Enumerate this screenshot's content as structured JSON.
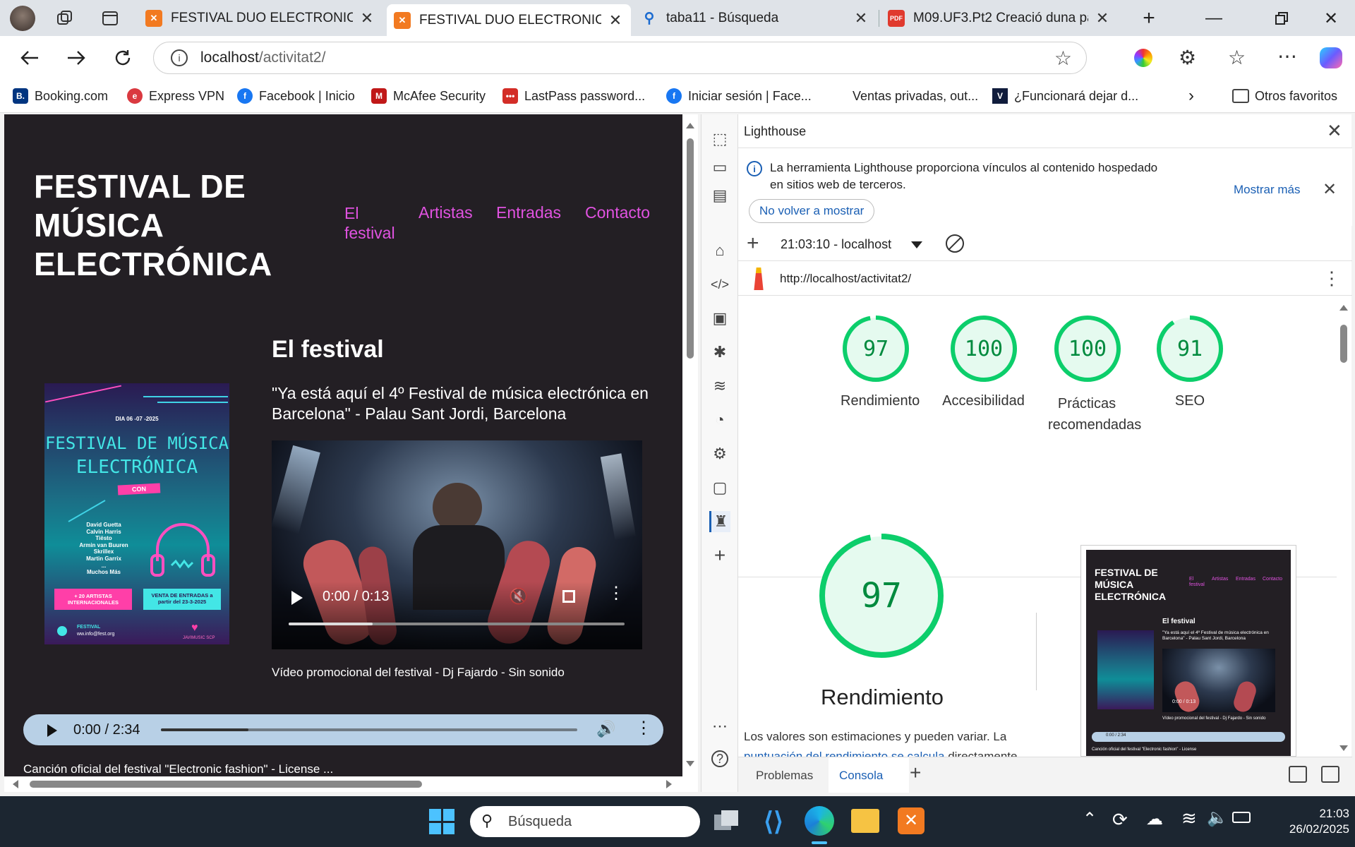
{
  "browser": {
    "tabs": [
      {
        "title": "FESTIVAL DUO ELECTRONIC",
        "icon": "xampp-icon"
      },
      {
        "title": "FESTIVAL DUO ELECTRONIC",
        "icon": "xampp-icon",
        "active": true
      },
      {
        "title": "taba11 - Búsqueda",
        "icon": "search-icon"
      },
      {
        "title": "M09.UF3.Pt2 Creació duna pàgin",
        "icon": "pdf-icon"
      }
    ],
    "url_host": "localhost",
    "url_path": "/activitat2/",
    "bookmarks": [
      {
        "label": "Booking.com",
        "icon": "booking-icon"
      },
      {
        "label": "Express VPN",
        "icon": "expressvpn-icon"
      },
      {
        "label": "Facebook | Inicio",
        "icon": "facebook-icon"
      },
      {
        "label": "McAfee Security",
        "icon": "mcafee-icon"
      },
      {
        "label": "LastPass password...",
        "icon": "lastpass-icon"
      },
      {
        "label": "Iniciar sesión | Face...",
        "icon": "facebook-icon"
      },
      {
        "label": "Ventas privadas, out...",
        "icon": ""
      },
      {
        "label": "¿Funcionará dejar d...",
        "icon": "v-icon"
      }
    ],
    "other_favorites": "Otros favoritos"
  },
  "site": {
    "title_lines": [
      "FESTIVAL DE",
      "MÚSICA",
      "ELECTRÓNICA"
    ],
    "nav": [
      "El festival",
      "Artistas",
      "Entradas",
      "Contacto"
    ],
    "section_title": "El festival",
    "quote": "\"Ya está aquí el 4º Festival de música electrónica en Barcelona\" - Palau Sant Jordi, Barcelona",
    "video_time": "0:00 / 0:13",
    "video_caption": "Vídeo promocional del festival - Dj Fajardo - Sin sonido",
    "audio_time": "0:00 / 2:34",
    "audio_caption": "Canción oficial del festival \"Electronic fashion\" - License ...",
    "poster": {
      "date": "DIA 06 -07 -2025",
      "title_lines": [
        "FESTIVAL DE MÚSICA",
        "ELECTRÓNICA"
      ],
      "con": "CON",
      "artists": [
        "David Guetta",
        "Calvin Harris",
        "Tiësto",
        "Armin van Buuren",
        "Skrillex",
        "Martin Garrix",
        "...",
        "Muchos Más"
      ],
      "badge_left": "+ 20 ARTISTAS INTERNACIONALES",
      "badge_right": "VENTA DE ENTRADAS a partir del 23-3-2025",
      "footer_left": "FESTIVAL",
      "footer_email": "ww.info@fest.org",
      "footer_right": "JAVIMUSIC SCP"
    }
  },
  "devtools": {
    "panel_title": "Lighthouse",
    "info_text": "La herramienta Lighthouse proporciona vínculos al contenido hospedado en sitios web de terceros.",
    "show_more": "Mostrar más",
    "dont_show": "No volver a mostrar",
    "report_time": "21:03:10 - localhost",
    "report_url": "http://localhost/activitat2/",
    "scores": [
      {
        "value": 97,
        "label": "Rendimiento"
      },
      {
        "value": 100,
        "label": "Accesibilidad"
      },
      {
        "value": 100,
        "label": "Prácticas recomendadas"
      },
      {
        "value": 91,
        "label": "SEO"
      }
    ],
    "big_score": {
      "value": 97,
      "label": "Rendimiento"
    },
    "note_text": "Los valores son estimaciones y pueden variar. La",
    "note_link": "puntuación del rendimiento se calcula",
    "note_tail": "directamente",
    "drawer_tabs": [
      "Problemas",
      "Consola"
    ],
    "thumb": {
      "title_lines": [
        "FESTIVAL DE",
        "MÚSICA",
        "ELECTRÓNICA"
      ],
      "nav": [
        "El festival",
        "Artistas",
        "Entradas",
        "Contacto"
      ],
      "section": "El festival",
      "quote": "\"Ya está aquí el 4º Festival de música electrónica en Barcelona\" - Palau Sant Jordi, Barcelona",
      "video_time": "0:00 / 0:13",
      "caption": "Vídeo promocional del festival - Dj Fajardo - Sin sonido",
      "audio_time": "0:00 / 2:34",
      "audio_caption": "Canción oficial del festival \"Electronic fashion\" - License"
    }
  },
  "taskbar": {
    "search_placeholder": "Búsqueda",
    "time": "21:03",
    "date": "26/02/2025"
  },
  "colors": {
    "accent_nav": "#e052e0",
    "page_bg": "#231f24",
    "score_green": "#0cce6b",
    "score_fill": "#e5faef"
  }
}
